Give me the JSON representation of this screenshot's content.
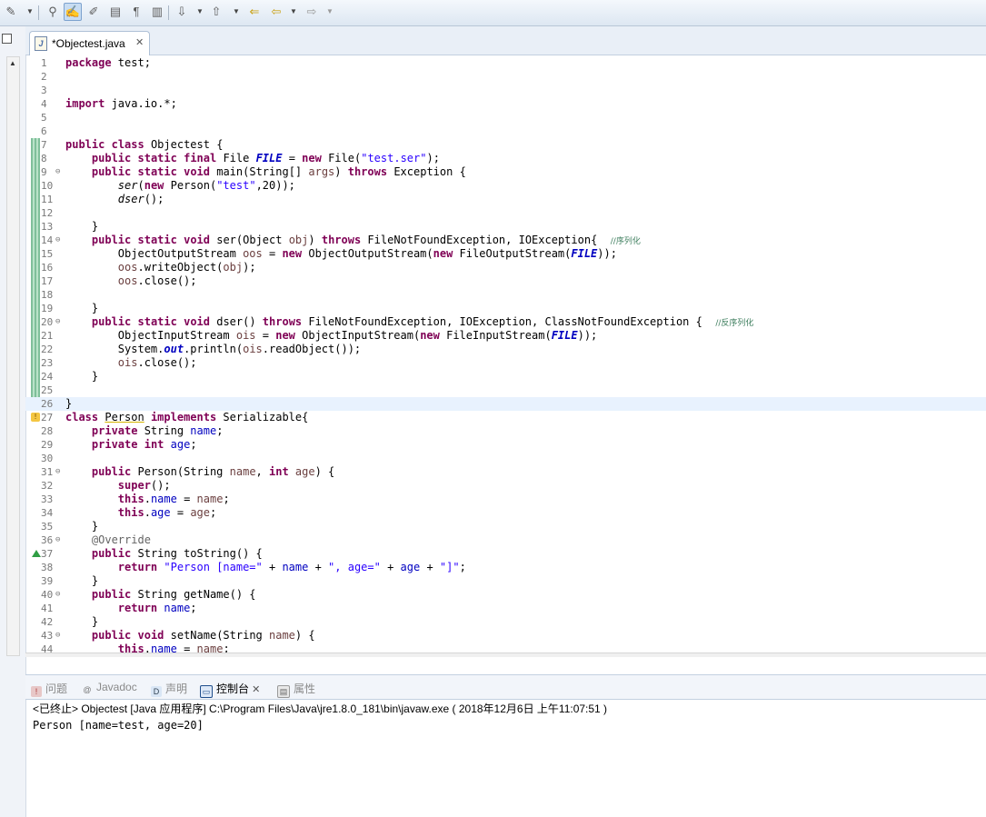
{
  "toolbar": {
    "icons": [
      "build-icon",
      "debug-icon",
      "highlight-icon",
      "toggle-mark-icon",
      "open-task-icon",
      "show-whitespace-icon",
      "block-select-icon",
      "next-annotation-icon",
      "prev-annotation-icon",
      "last-edit-icon",
      "back-icon",
      "forward-icon"
    ]
  },
  "editor": {
    "tab_label": "*Objectest.java",
    "tab_close": "✕",
    "lines": [
      {
        "n": "1",
        "html": "<span class='kw'>package</span> test;"
      },
      {
        "n": "2",
        "html": ""
      },
      {
        "n": "3",
        "html": ""
      },
      {
        "n": "4",
        "html": "<span class='kw'>import</span> java.io.*;"
      },
      {
        "n": "5",
        "html": ""
      },
      {
        "n": "6",
        "html": ""
      },
      {
        "n": "7",
        "html": "<span class='kw'>public</span> <span class='kw'>class</span> Objectest {"
      },
      {
        "n": "8",
        "html": "    <span class='kw'>public</span> <span class='kw'>static</span> <span class='kw'>final</span> File <span class='sfld'>FILE</span> = <span class='kw'>new</span> File(<span class='str'>\"test.ser\"</span>);"
      },
      {
        "n": "9",
        "fold": true,
        "html": "    <span class='kw'>public</span> <span class='kw'>static</span> <span class='kw'>void</span> main(String[] <span class='var'>args</span>) <span class='kw'>throws</span> Exception {"
      },
      {
        "n": "10",
        "html": "        <span class='sm'>ser</span>(<span class='kw'>new</span> Person(<span class='str'>\"test\"</span>,20));"
      },
      {
        "n": "11",
        "html": "        <span class='sm'>dser</span>();"
      },
      {
        "n": "12",
        "html": ""
      },
      {
        "n": "13",
        "html": "    }"
      },
      {
        "n": "14",
        "fold": true,
        "html": "    <span class='kw'>public</span> <span class='kw'>static</span> <span class='kw'>void</span> ser(Object <span class='var'>obj</span>) <span class='kw'>throws</span> FileNotFoundException, IOException{  <span class='cmt'>//序列化</span>"
      },
      {
        "n": "15",
        "html": "        ObjectOutputStream <span class='var'>oos</span> = <span class='kw'>new</span> ObjectOutputStream(<span class='kw'>new</span> FileOutputStream(<span class='sfld'>FILE</span>));"
      },
      {
        "n": "16",
        "html": "        <span class='var'>oos</span>.writeObject(<span class='var'>obj</span>);"
      },
      {
        "n": "17",
        "html": "        <span class='var'>oos</span>.close();"
      },
      {
        "n": "18",
        "html": ""
      },
      {
        "n": "19",
        "html": "    }"
      },
      {
        "n": "20",
        "fold": true,
        "html": "    <span class='kw'>public</span> <span class='kw'>static</span> <span class='kw'>void</span> dser() <span class='kw'>throws</span> FileNotFoundException, IOException, ClassNotFoundException {  <span class='cmt'>//反序列化</span>"
      },
      {
        "n": "21",
        "html": "        ObjectInputStream <span class='var'>ois</span> = <span class='kw'>new</span> ObjectInputStream(<span class='kw'>new</span> FileInputStream(<span class='sfld'>FILE</span>));"
      },
      {
        "n": "22",
        "html": "        System.<span class='sfld'>out</span>.println(<span class='var'>ois</span>.readObject());"
      },
      {
        "n": "23",
        "html": "        <span class='var'>ois</span>.close();"
      },
      {
        "n": "24",
        "html": "    }"
      },
      {
        "n": "25",
        "html": ""
      },
      {
        "n": "26",
        "current": true,
        "html": "}"
      },
      {
        "n": "27",
        "marker": "warn",
        "html": "<span class='kw'>class</span> <span class='u'>Person</span> <span class='kw'>implements</span> Serializable{"
      },
      {
        "n": "28",
        "html": "    <span class='kw'>private</span> String <span class='fld'>name</span>;"
      },
      {
        "n": "29",
        "html": "    <span class='kw'>private</span> <span class='kw'>int</span> <span class='fld'>age</span>;"
      },
      {
        "n": "30",
        "html": ""
      },
      {
        "n": "31",
        "fold": true,
        "html": "    <span class='kw'>public</span> Person(String <span class='var'>name</span>, <span class='kw'>int</span> <span class='var'>age</span>) {"
      },
      {
        "n": "32",
        "html": "        <span class='kw'>super</span>();"
      },
      {
        "n": "33",
        "html": "        <span class='kw'>this</span>.<span class='fld'>name</span> = <span class='var'>name</span>;"
      },
      {
        "n": "34",
        "html": "        <span class='kw'>this</span>.<span class='fld'>age</span> = <span class='var'>age</span>;"
      },
      {
        "n": "35",
        "html": "    }"
      },
      {
        "n": "36",
        "fold": true,
        "html": "    <span class='ann'>@Override</span>"
      },
      {
        "n": "37",
        "marker": "override",
        "html": "    <span class='kw'>public</span> String toString() {"
      },
      {
        "n": "38",
        "html": "        <span class='kw'>return</span> <span class='str'>\"Person [name=\"</span> + <span class='fld'>name</span> + <span class='str'>\", age=\"</span> + <span class='fld'>age</span> + <span class='str'>\"]\"</span>;"
      },
      {
        "n": "39",
        "html": "    }"
      },
      {
        "n": "40",
        "fold": true,
        "html": "    <span class='kw'>public</span> String getName() {"
      },
      {
        "n": "41",
        "html": "        <span class='kw'>return</span> <span class='fld'>name</span>;"
      },
      {
        "n": "42",
        "html": "    }"
      },
      {
        "n": "43",
        "fold": true,
        "html": "    <span class='kw'>public</span> <span class='kw'>void</span> setName(String <span class='var'>name</span>) {"
      },
      {
        "n": "44",
        "html": "        <span class='kw'>this</span>.<span class='fld'>name</span> = <span class='var'>name</span>;"
      }
    ]
  },
  "console": {
    "tabs": [
      {
        "label": "问题",
        "icon": "problems-icon",
        "active": false
      },
      {
        "label": "Javadoc",
        "icon": "javadoc-icon",
        "active": false
      },
      {
        "label": "声明",
        "icon": "declaration-icon",
        "active": false
      },
      {
        "label": "控制台",
        "icon": "console-icon",
        "active": true
      },
      {
        "label": "属性",
        "icon": "properties-icon",
        "active": false
      }
    ],
    "close_glyph": "✕",
    "header": "<已终止> Objectest [Java 应用程序] C:\\Program Files\\Java\\jre1.8.0_181\\bin\\javaw.exe ( 2018年12月6日 上午11:07:51 )",
    "output": "Person [name=test, age=20]"
  }
}
